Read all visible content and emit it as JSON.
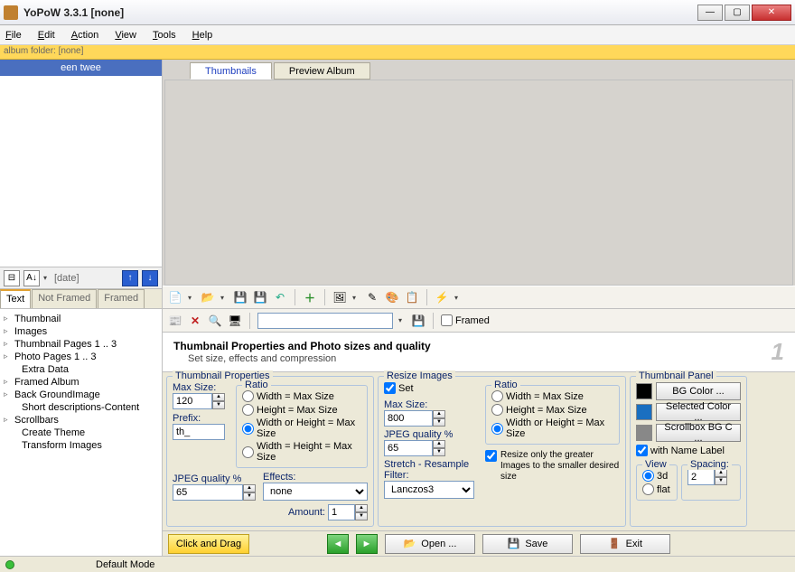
{
  "window": {
    "title": "YoPoW 3.3.1 [none]"
  },
  "menu": {
    "file": "File",
    "edit": "Edit",
    "action": "Action",
    "view": "View",
    "tools": "Tools",
    "help": "Help"
  },
  "folderstrip": "album folder: [none]",
  "album_list": {
    "item0": "een twee"
  },
  "left_toolbar": {
    "sort": "A↓",
    "date": "[date]"
  },
  "left_tabs": {
    "text": "Text",
    "notframed": "Not Framed",
    "framed": "Framed"
  },
  "tree": {
    "thumbnail": "Thumbnail",
    "images": "Images",
    "thumbpages": "Thumbnail Pages 1 .. 3",
    "photopages": "Photo Pages 1 .. 3",
    "extradata": "Extra Data",
    "framedalbum": "Framed Album",
    "bgimage": "Back GroundImage",
    "shortdesc": "Short descriptions-Content",
    "scrollbars": "Scrollbars",
    "createtheme": "Create Theme",
    "transform": "Transform Images"
  },
  "right_tabs": {
    "thumbs": "Thumbnails",
    "preview": "Preview Album"
  },
  "toolrow2": {
    "framed": "Framed"
  },
  "prop_header": {
    "title": "Thumbnail Properties and Photo sizes and quality",
    "sub": "Set size, effects and compression",
    "num": "1"
  },
  "tp": {
    "legend": "Thumbnail Properties",
    "maxsize_lbl": "Max Size:",
    "maxsize": "120",
    "prefix_lbl": "Prefix:",
    "prefix": "th_",
    "jpeg_lbl": "JPEG quality  %",
    "jpeg": "65",
    "ratio_legend": "Ratio",
    "r1": "Width = Max Size",
    "r2": "Height = Max Size",
    "r3": "Width or Height = Max Size",
    "r4": "Width = Height = Max Size",
    "effects_lbl": "Effects:",
    "effects": "none",
    "amount_lbl": "Amount:",
    "amount": "1"
  },
  "ri": {
    "legend": "Resize Images",
    "set": "Set",
    "maxsize_lbl": "Max Size:",
    "maxsize": "800",
    "jpeg_lbl": "JPEG quality %",
    "jpeg": "65",
    "stretch_lbl": "Stretch - Resample Filter:",
    "stretch": "Lanczos3",
    "ratio_legend": "Ratio",
    "r1": "Width = Max Size",
    "r2": "Height = Max Size",
    "r3": "Width or Height = Max Size",
    "resizeonly": "Resize only the greater Images to the smaller desired size"
  },
  "panel": {
    "legend": "Thumbnail Panel",
    "bg": "BG Color ...",
    "sel": "Selected Color ...",
    "sb": "Scrollbox BG C ...",
    "withname": "with Name Label",
    "view_legend": "View",
    "v3d": "3d",
    "vflat": "flat",
    "spacing_lbl": "Spacing:",
    "spacing": "2"
  },
  "btnbar": {
    "clickdrag": "Click and Drag",
    "open": "Open ...",
    "save": "Save",
    "exit": "Exit"
  },
  "status": {
    "mode": "Default Mode"
  }
}
